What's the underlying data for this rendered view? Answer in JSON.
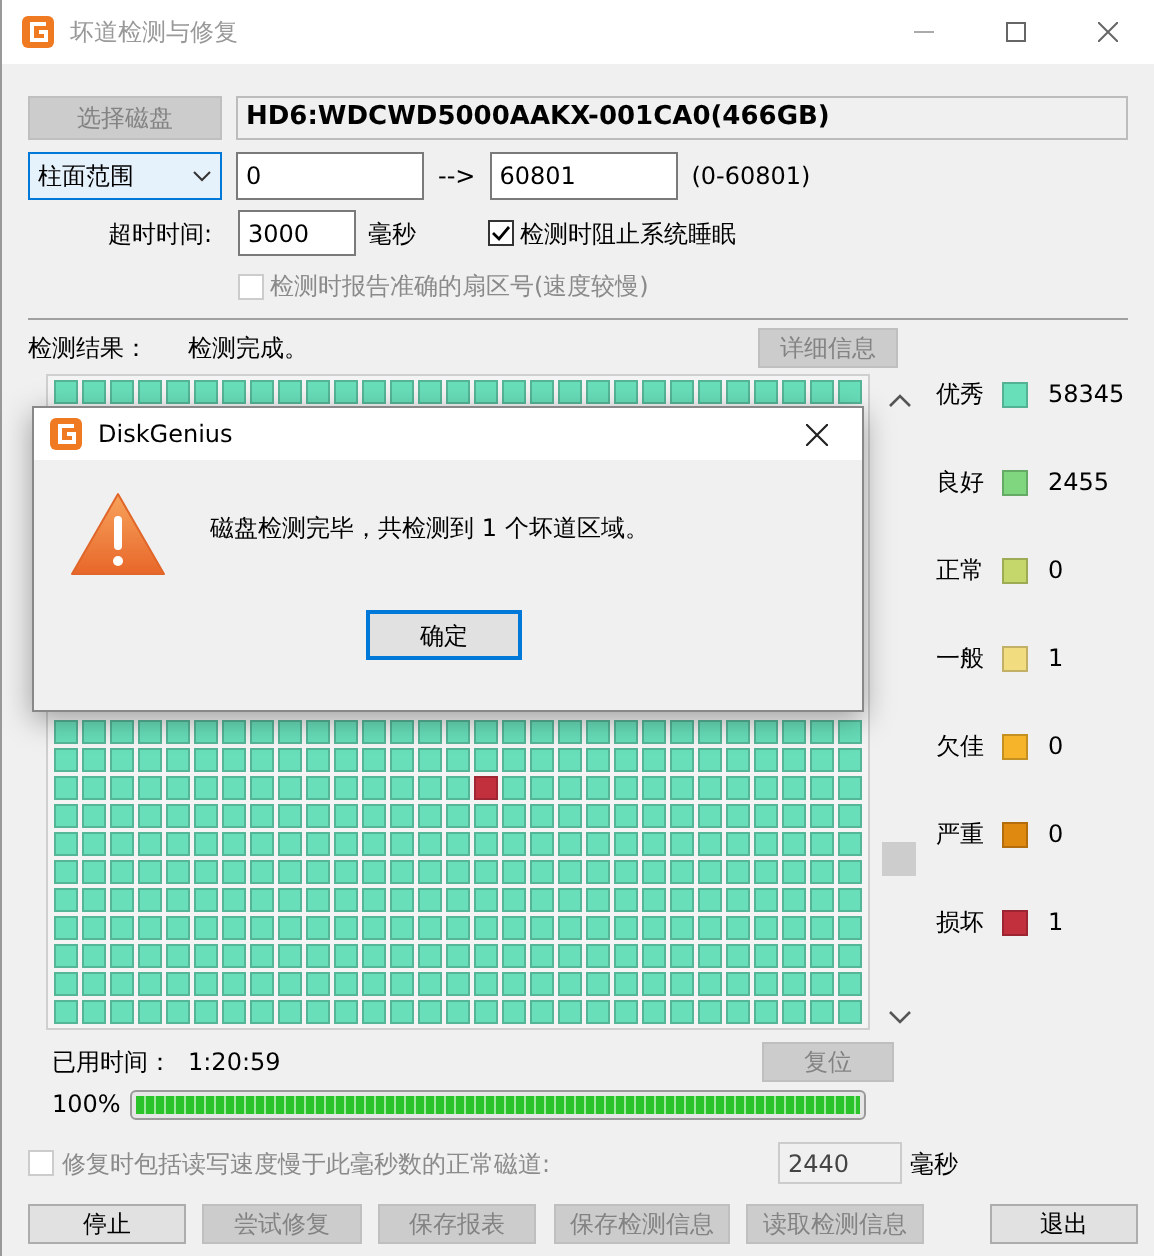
{
  "window": {
    "title": "坏道检测与修复"
  },
  "disk_button": {
    "label": "选择磁盘",
    "disabled": true
  },
  "disk_name": "HD6:WDCWD5000AAKX-001CA0(466GB)",
  "range": {
    "mode": "柱面范围",
    "from": "0",
    "arrow": "-->",
    "to": "60801",
    "hint": "(0-60801)"
  },
  "timeout": {
    "label": "超时时间:",
    "value": "3000",
    "unit": "毫秒"
  },
  "options": [
    {
      "label": "检测时阻止系统睡眠",
      "checked": true,
      "disabled": false
    },
    {
      "label": "检测时报告准确的扇区号(速度较慢)",
      "checked": false,
      "disabled": true
    }
  ],
  "result": {
    "label": "检测结果：",
    "value": "检测完成。",
    "details_button": {
      "label": "详细信息",
      "disabled": true
    }
  },
  "block_map": {
    "top_rows": [
      {
        "damaged": [
          false,
          false,
          false,
          false,
          false,
          false,
          false,
          false,
          false,
          false,
          false,
          false,
          false,
          false,
          false,
          false,
          false,
          false,
          false,
          false,
          false,
          false,
          false,
          false,
          false,
          false,
          false,
          false,
          false
        ]
      }
    ],
    "bottom_rows": [
      {
        "damaged": [
          false,
          false,
          false,
          false,
          false,
          false,
          false,
          false,
          false,
          false,
          false,
          false,
          false,
          false,
          false,
          false,
          false,
          false,
          false,
          false,
          false,
          false,
          false,
          false,
          false,
          false,
          false,
          false,
          false
        ]
      },
      {
        "damaged": [
          false,
          false,
          false,
          false,
          false,
          false,
          false,
          false,
          false,
          false,
          false,
          false,
          false,
          false,
          false,
          false,
          false,
          false,
          false,
          false,
          false,
          false,
          false,
          false,
          false,
          false,
          false,
          false,
          false
        ]
      },
      {
        "damaged": [
          false,
          false,
          false,
          false,
          false,
          false,
          false,
          false,
          false,
          false,
          false,
          false,
          false,
          false,
          false,
          true,
          false,
          false,
          false,
          false,
          false,
          false,
          false,
          false,
          false,
          false,
          false,
          false,
          false
        ]
      },
      {
        "damaged": [
          false,
          false,
          false,
          false,
          false,
          false,
          false,
          false,
          false,
          false,
          false,
          false,
          false,
          false,
          false,
          false,
          false,
          false,
          false,
          false,
          false,
          false,
          false,
          false,
          false,
          false,
          false,
          false,
          false
        ]
      },
      {
        "damaged": [
          false,
          false,
          false,
          false,
          false,
          false,
          false,
          false,
          false,
          false,
          false,
          false,
          false,
          false,
          false,
          false,
          false,
          false,
          false,
          false,
          false,
          false,
          false,
          false,
          false,
          false,
          false,
          false,
          false
        ]
      },
      {
        "damaged": [
          false,
          false,
          false,
          false,
          false,
          false,
          false,
          false,
          false,
          false,
          false,
          false,
          false,
          false,
          false,
          false,
          false,
          false,
          false,
          false,
          false,
          false,
          false,
          false,
          false,
          false,
          false,
          false,
          false
        ]
      },
      {
        "damaged": [
          false,
          false,
          false,
          false,
          false,
          false,
          false,
          false,
          false,
          false,
          false,
          false,
          false,
          false,
          false,
          false,
          false,
          false,
          false,
          false,
          false,
          false,
          false,
          false,
          false,
          false,
          false,
          false,
          false
        ]
      },
      {
        "damaged": [
          false,
          false,
          false,
          false,
          false,
          false,
          false,
          false,
          false,
          false,
          false,
          false,
          false,
          false,
          false,
          false,
          false,
          false,
          false,
          false,
          false,
          false,
          false,
          false,
          false,
          false,
          false,
          false,
          false
        ]
      },
      {
        "damaged": [
          false,
          false,
          false,
          false,
          false,
          false,
          false,
          false,
          false,
          false,
          false,
          false,
          false,
          false,
          false,
          false,
          false,
          false,
          false,
          false,
          false,
          false,
          false,
          false,
          false,
          false,
          false,
          false,
          false
        ]
      },
      {
        "damaged": [
          false,
          false,
          false,
          false,
          false,
          false,
          false,
          false,
          false,
          false,
          false,
          false,
          false,
          false,
          false,
          false,
          false,
          false,
          false,
          false,
          false,
          false,
          false,
          false,
          false,
          false,
          false,
          false,
          false
        ]
      },
      {
        "damaged": [
          false,
          false,
          false,
          false,
          false,
          false,
          false,
          false,
          false,
          false,
          false,
          false,
          false,
          false,
          false,
          false,
          false,
          false,
          false,
          false,
          false,
          false,
          false,
          false,
          false,
          false,
          false,
          false,
          false
        ]
      }
    ]
  },
  "legend": [
    {
      "label": "优秀",
      "color": "#68dfb9",
      "count": "58345"
    },
    {
      "label": "良好",
      "color": "#7fd67f",
      "count": "2455"
    },
    {
      "label": "正常",
      "color": "#c5d66a",
      "count": "0"
    },
    {
      "label": "一般",
      "color": "#f2dc80",
      "count": "1"
    },
    {
      "label": "欠佳",
      "color": "#f5b42a",
      "count": "0"
    },
    {
      "label": "严重",
      "color": "#e08910",
      "count": "0"
    },
    {
      "label": "损坏",
      "color": "#c22f3d",
      "count": "1"
    }
  ],
  "elapsed": {
    "label": "已用时间：",
    "value": "1:20:59"
  },
  "reset_button": {
    "label": "复位",
    "disabled": true
  },
  "progress": {
    "reading": "100%",
    "level": 1
  },
  "slow_repair": {
    "label": "修复时包括读写速度慢于此毫秒数的正常磁道:",
    "checked": false,
    "disabled": true,
    "value": "2440",
    "unit": "毫秒"
  },
  "buttons": [
    {
      "label": "停止",
      "disabled": false
    },
    {
      "label": "尝试修复",
      "disabled": true
    },
    {
      "label": "保存报表",
      "disabled": true
    },
    {
      "label": "保存检测信息",
      "disabled": true
    },
    {
      "label": "读取检测信息",
      "disabled": true
    },
    {
      "label": "退出",
      "disabled": false
    }
  ],
  "dialog": {
    "title": "DiskGenius",
    "message": "磁盘检测完毕，共检测到 1 个坏道区域。",
    "button": "确定"
  }
}
